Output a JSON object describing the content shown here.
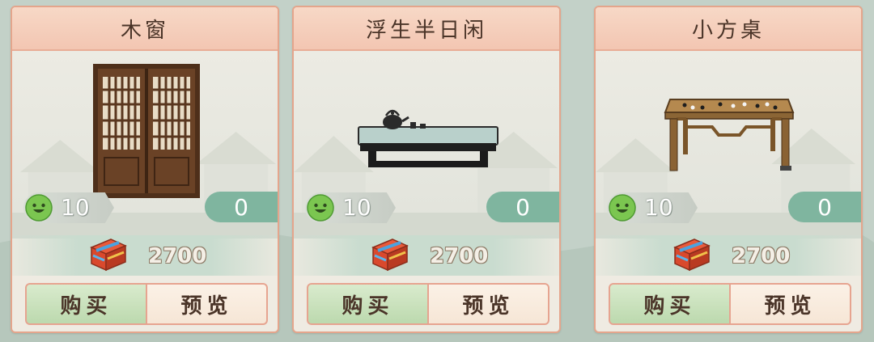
{
  "shop": {
    "items": [
      {
        "name": "木窗",
        "hearts": "10",
        "owned": "0",
        "cost": "2700",
        "buy_label": "购买",
        "preview_label": "预览",
        "furniture": "wooden-window"
      },
      {
        "name": "浮生半日闲",
        "hearts": "10",
        "owned": "0",
        "cost": "2700",
        "buy_label": "购买",
        "preview_label": "预览",
        "furniture": "tea-table"
      },
      {
        "name": "小方桌",
        "hearts": "10",
        "owned": "0",
        "cost": "2700",
        "buy_label": "购买",
        "preview_label": "预览",
        "furniture": "go-board-table"
      }
    ]
  },
  "icons": {
    "currency_heart": "smiley-face-icon",
    "currency_cost": "treasure-chest-icon"
  },
  "colors": {
    "card_border": "#e4a58c",
    "title_bg": "#f3c6b2",
    "owned_pill": "#7fb59f",
    "buy_button": "#c6dfb8",
    "preview_button": "#f8ebdd",
    "smiley_green": "#7bc650"
  }
}
